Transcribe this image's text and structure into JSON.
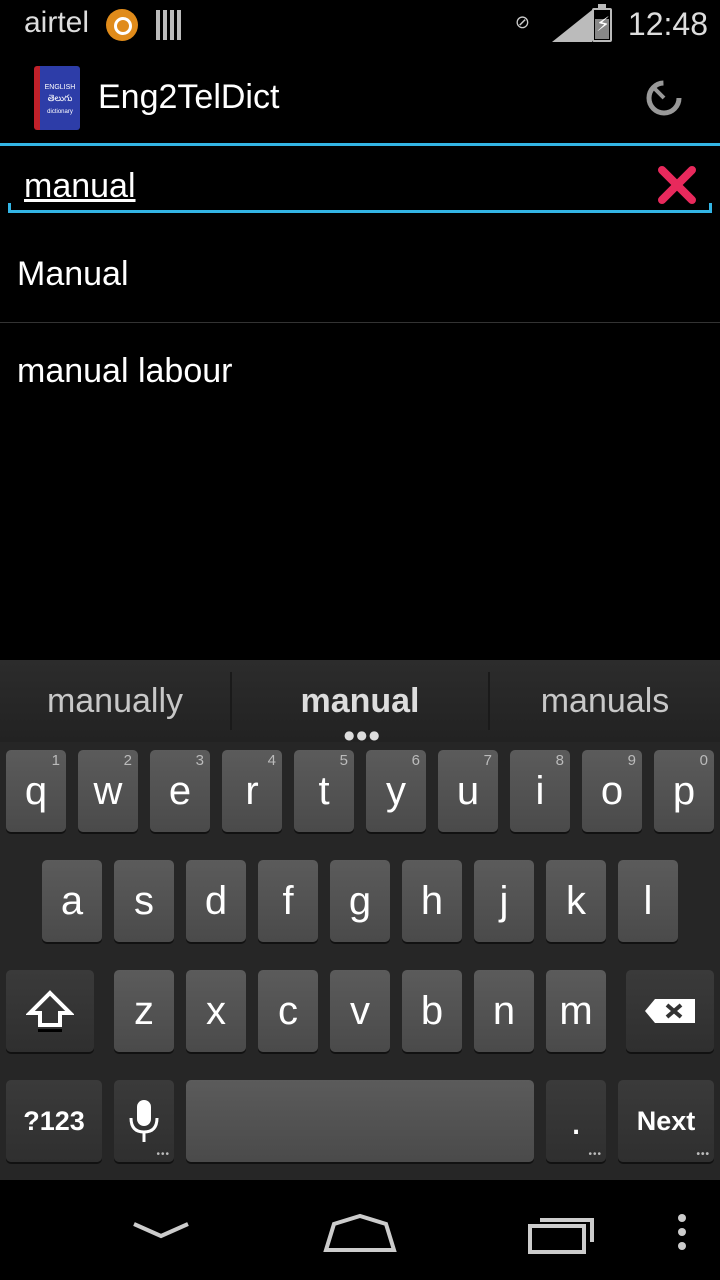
{
  "status_bar": {
    "carrier": "airtel",
    "time": "12:48"
  },
  "app": {
    "title": "Eng2TelDict",
    "icon_lines": [
      "ENGLISH",
      "తెలుగు",
      "dictionary"
    ]
  },
  "search": {
    "value": "manual",
    "clear_icon": "close-x-icon",
    "clear_color": "#e8295c",
    "accent": "#33b5e5"
  },
  "results": [
    "Manual",
    "manual labour"
  ],
  "keyboard": {
    "suggestions": [
      "manually",
      "manual",
      "manuals"
    ],
    "row1": [
      {
        "k": "q",
        "h": "1"
      },
      {
        "k": "w",
        "h": "2"
      },
      {
        "k": "e",
        "h": "3"
      },
      {
        "k": "r",
        "h": "4"
      },
      {
        "k": "t",
        "h": "5"
      },
      {
        "k": "y",
        "h": "6"
      },
      {
        "k": "u",
        "h": "7"
      },
      {
        "k": "i",
        "h": "8"
      },
      {
        "k": "o",
        "h": "9"
      },
      {
        "k": "p",
        "h": "0"
      }
    ],
    "row2": [
      "a",
      "s",
      "d",
      "f",
      "g",
      "h",
      "j",
      "k",
      "l"
    ],
    "row3": [
      "z",
      "x",
      "c",
      "v",
      "b",
      "n",
      "m"
    ],
    "symbols_label": "?123",
    "period_label": ".",
    "next_label": "Next"
  }
}
